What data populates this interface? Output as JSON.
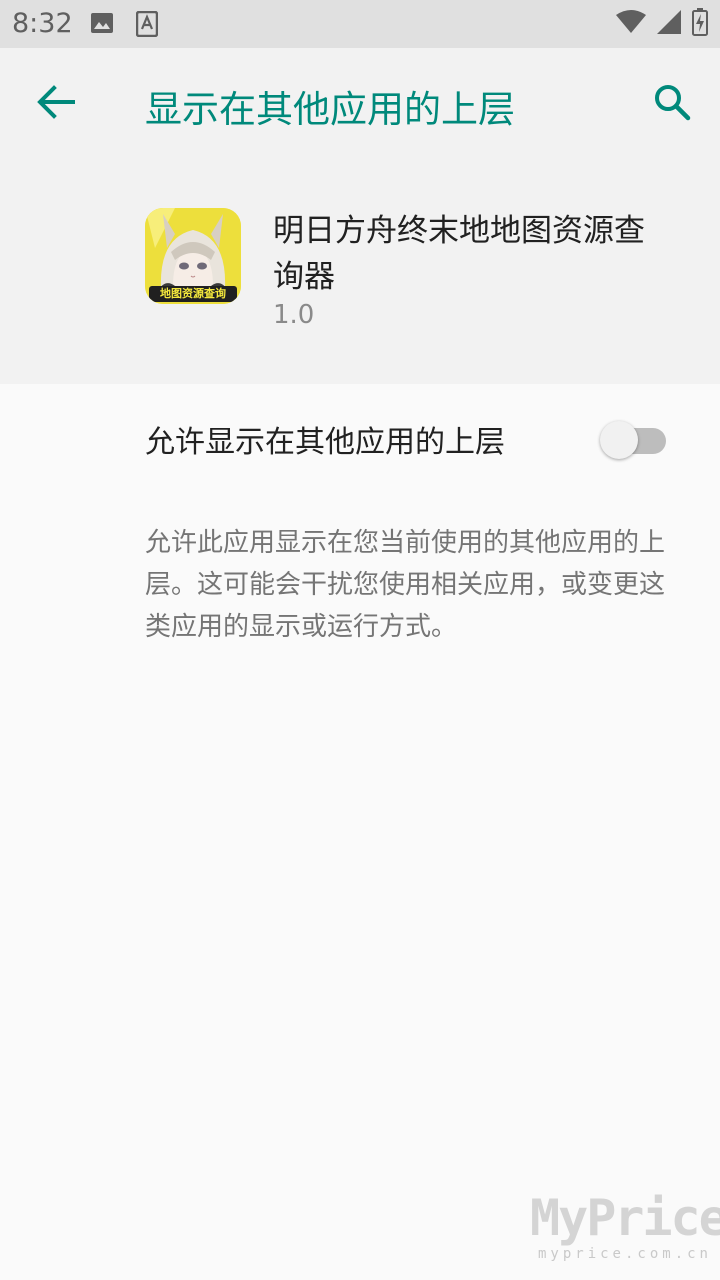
{
  "status_bar": {
    "time": "8:32",
    "left_icons": [
      "image-icon",
      "text-icon"
    ],
    "right_icons": [
      "wifi-icon",
      "signal-icon",
      "battery-icon"
    ]
  },
  "header": {
    "title": "显示在其他应用的上层",
    "back_icon": "back-arrow-icon",
    "search_icon": "search-icon",
    "accent_color": "#00897b"
  },
  "app": {
    "name": "明日方舟终末地地图资源查询器",
    "version": "1.0",
    "icon_caption": "地图资源查询"
  },
  "setting": {
    "label": "允许显示在其他应用的上层",
    "enabled": false,
    "description": "允许此应用显示在您当前使用的其他应用的上层。这可能会干扰您使用相关应用，或变更这类应用的显示或运行方式。"
  },
  "watermark": {
    "brand": "MyPrice",
    "url": "myprice.com.cn"
  }
}
